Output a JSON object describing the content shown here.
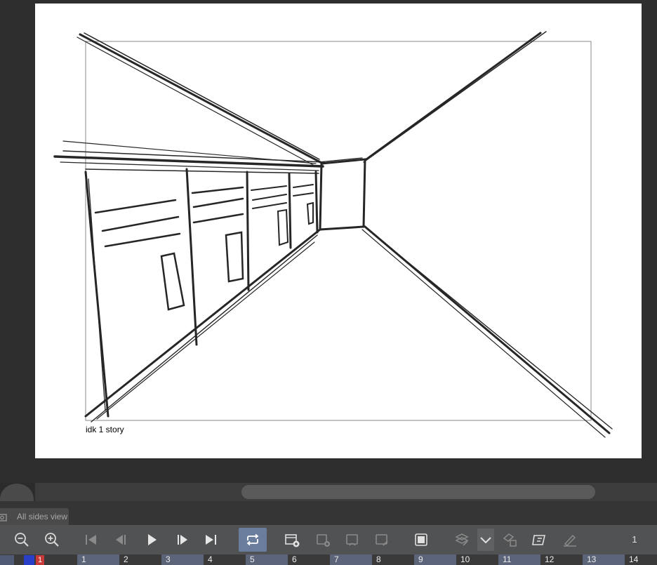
{
  "canvas": {
    "frame_caption": "idk 1 story",
    "sketch_description_icon": "pencil-sketch-hallway"
  },
  "view_tabs": {
    "active_label": "All sides view"
  },
  "toolbar": {
    "buttons": [
      {
        "name": "zoom-out-button",
        "icon": "zoom-out-icon"
      },
      {
        "name": "zoom-in-button",
        "icon": "zoom-in-icon"
      },
      {
        "name": "first-frame-button",
        "icon": "skip-to-start-icon"
      },
      {
        "name": "previous-frame-button",
        "icon": "step-back-icon"
      },
      {
        "name": "play-button",
        "icon": "play-icon"
      },
      {
        "name": "next-frame-button",
        "icon": "step-forward-icon"
      },
      {
        "name": "last-frame-button",
        "icon": "skip-to-end-icon"
      },
      {
        "name": "loop-playback-button",
        "icon": "loop-icon",
        "active": true
      },
      {
        "name": "new-animation-folder-button",
        "icon": "new-folder-icon"
      },
      {
        "name": "new-cel-button",
        "icon": "new-cel-icon"
      },
      {
        "name": "specify-cel-button",
        "icon": "specify-cel-icon"
      },
      {
        "name": "rename-cel-button",
        "icon": "rename-cel-icon"
      },
      {
        "name": "onion-skin-button",
        "icon": "onion-skin-icon"
      },
      {
        "name": "light-table-button",
        "icon": "light-table-icon"
      },
      {
        "name": "more-options-button",
        "icon": "chevron-down-icon"
      },
      {
        "name": "delete-cel-button",
        "icon": "delete-cel-icon"
      },
      {
        "name": "edit-timeline-button",
        "icon": "edit-timeline-icon"
      },
      {
        "name": "pen-button",
        "icon": "pen-icon"
      }
    ],
    "frame_number": "1"
  },
  "timeline": {
    "current_frame": "1",
    "frame_numbers": [
      "1",
      "2",
      "3",
      "4",
      "5",
      "6",
      "7",
      "8",
      "9",
      "10",
      "11",
      "12",
      "13",
      "14"
    ]
  },
  "colors": {
    "background": "#2e2e2e",
    "paper": "#ffffff",
    "toolbar": "#505254",
    "active_button": "#6a7d9c",
    "current_frame_marker": "#c83a3a",
    "track_marker": "#2a3fc8"
  }
}
